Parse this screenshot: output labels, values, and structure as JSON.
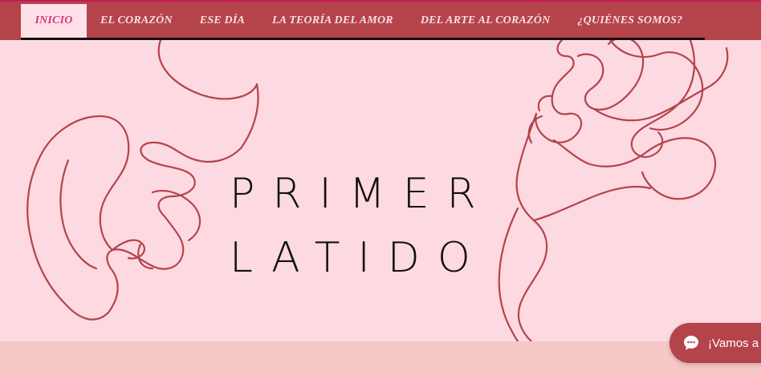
{
  "nav": {
    "items": [
      {
        "label": "INICIO",
        "active": true
      },
      {
        "label": "EL CORAZÓN",
        "active": false
      },
      {
        "label": "ESE DÍA",
        "active": false
      },
      {
        "label": "LA TEORÍA DEL AMOR",
        "active": false
      },
      {
        "label": "DEL ARTE AL CORAZÓN",
        "active": false
      },
      {
        "label": "¿QUIÉNES SOMOS?",
        "active": false
      }
    ]
  },
  "hero": {
    "title_line1": "PRIMER",
    "title_line2": "LATIDO",
    "art_icon": "line-art-faces"
  },
  "chat": {
    "label": "¡Vamos a",
    "icon": "chat-bubble-icon"
  },
  "colors": {
    "nav_bg": "#b5434a",
    "hero_bg": "#fdd9e2",
    "line_art": "#b5434a",
    "active_tab_bg": "#fde0e8",
    "active_tab_text": "#d6397c",
    "bottom_strip": "#f7c8c8"
  }
}
